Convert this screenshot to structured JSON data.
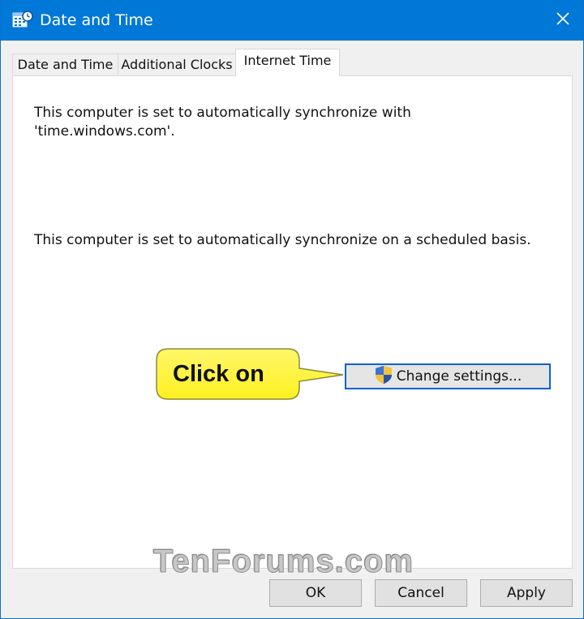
{
  "window": {
    "title": "Date and Time",
    "icon": "date-time-icon",
    "close_icon": "close-icon",
    "accent_color": "#0078d7"
  },
  "tabs": [
    {
      "label": "Date and Time",
      "active": false
    },
    {
      "label": "Additional Clocks",
      "active": false
    },
    {
      "label": "Internet Time",
      "active": true
    }
  ],
  "panel": {
    "sync_text_line1": "This computer is set to automatically synchronize with",
    "sync_text_line2": "'time.windows.com'.",
    "schedule_text": "This computer is set to automatically synchronize on a scheduled basis.",
    "change_settings_label": "Change settings...",
    "change_settings_icon": "uac-shield-icon"
  },
  "callout": {
    "text": "Click on",
    "color": "#fff335"
  },
  "watermark": {
    "text": "TenForums.com"
  },
  "footer": {
    "ok_label": "OK",
    "cancel_label": "Cancel",
    "apply_label": "Apply"
  }
}
